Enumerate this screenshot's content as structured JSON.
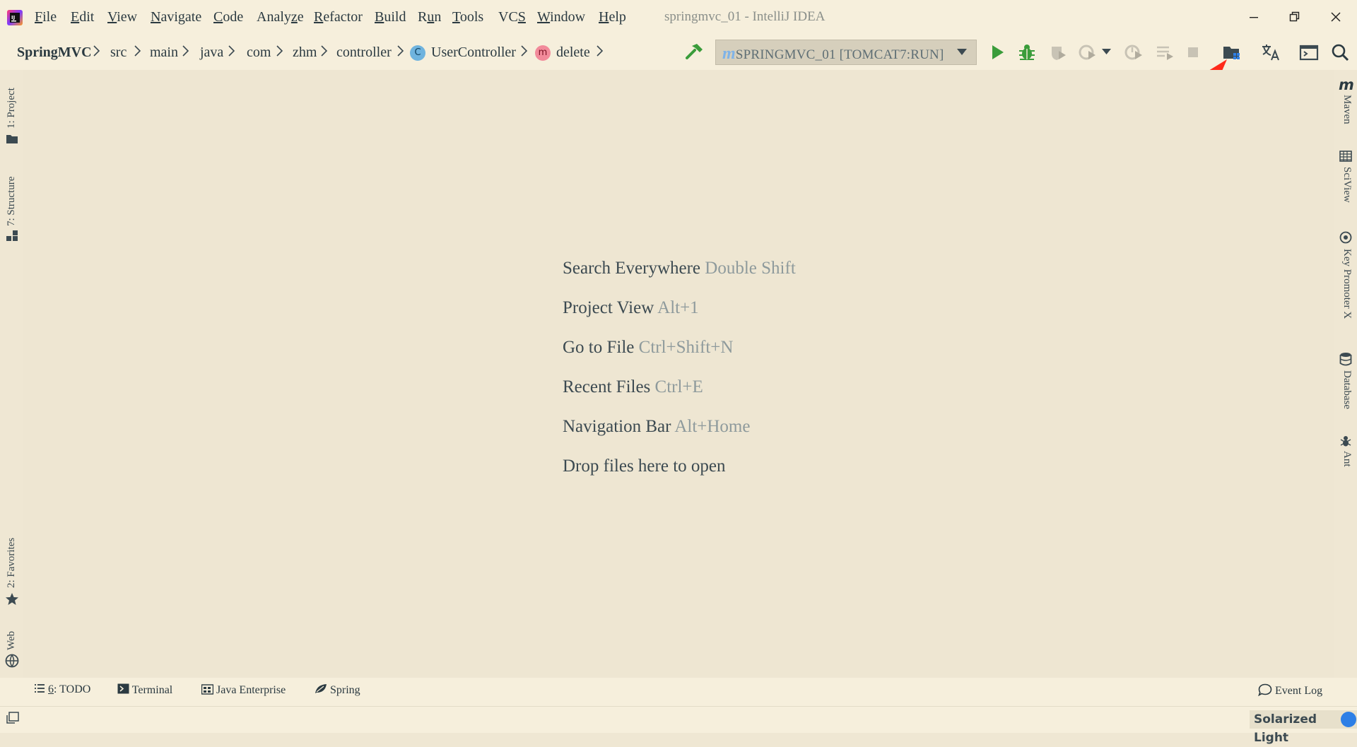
{
  "window": {
    "title": "springmvc_01 - IntelliJ IDEA",
    "controls": [
      "minimize",
      "restore",
      "close"
    ]
  },
  "menu": [
    {
      "mnemonic": "F",
      "rest": "ile"
    },
    {
      "mnemonic": "E",
      "rest": "dit"
    },
    {
      "mnemonic": "V",
      "rest": "iew"
    },
    {
      "mnemonic": "N",
      "rest": "avigate"
    },
    {
      "mnemonic": "C",
      "rest": "ode"
    },
    {
      "pre": "Analy",
      "mnemonic": "z",
      "rest": "e"
    },
    {
      "mnemonic": "R",
      "rest": "efactor"
    },
    {
      "mnemonic": "B",
      "rest": "uild"
    },
    {
      "pre": "R",
      "mnemonic": "u",
      "rest": "n"
    },
    {
      "mnemonic": "T",
      "rest": "ools"
    },
    {
      "pre": "VC",
      "mnemonic": "S",
      "rest": ""
    },
    {
      "mnemonic": "W",
      "rest": "indow"
    },
    {
      "mnemonic": "H",
      "rest": "elp"
    }
  ],
  "breadcrumb": {
    "project": "SpringMVC",
    "items": [
      "src",
      "main",
      "java",
      "com",
      "zhm",
      "controller"
    ],
    "class_badge": "C",
    "class_name": "UserController",
    "method_badge": "m",
    "method_name": "delete"
  },
  "run_config": {
    "badge": "m",
    "label": "SPRINGMVC_01 [TOMCAT7:RUN]"
  },
  "editor_hints": [
    {
      "action": "Search Everywhere",
      "shortcut": "Double Shift"
    },
    {
      "action": "Project View",
      "shortcut": "Alt+1"
    },
    {
      "action": "Go to File",
      "shortcut": "Ctrl+Shift+N"
    },
    {
      "action": "Recent Files",
      "shortcut": "Ctrl+E"
    },
    {
      "action": "Navigation Bar",
      "shortcut": "Alt+Home"
    },
    {
      "action": "Drop files here to open",
      "shortcut": ""
    }
  ],
  "left_tool_windows": {
    "project": "1: Project",
    "structure": "7: Structure",
    "favorites": "2: Favorites",
    "web": "Web"
  },
  "right_tool_windows": {
    "maven_badge": "m",
    "maven": "Maven",
    "sciview": "SciView",
    "key_promoter": "Key Promoter X",
    "database": "Database",
    "ant": "Ant"
  },
  "bottom_tool_windows": {
    "todo_mnemonic": "6",
    "todo_rest": ": TODO",
    "terminal": "Terminal",
    "java_enterprise": "Java Enterprise",
    "spring": "Spring",
    "event_log": "Event Log"
  },
  "status": {
    "theme": "Solarized Light"
  },
  "colors": {
    "background": "#eee6d2",
    "bar": "#f6efdc",
    "run_green": "#3a9c3a",
    "annotation_red": "#ff2a1a",
    "accent_blue": "#2d7fe6"
  }
}
